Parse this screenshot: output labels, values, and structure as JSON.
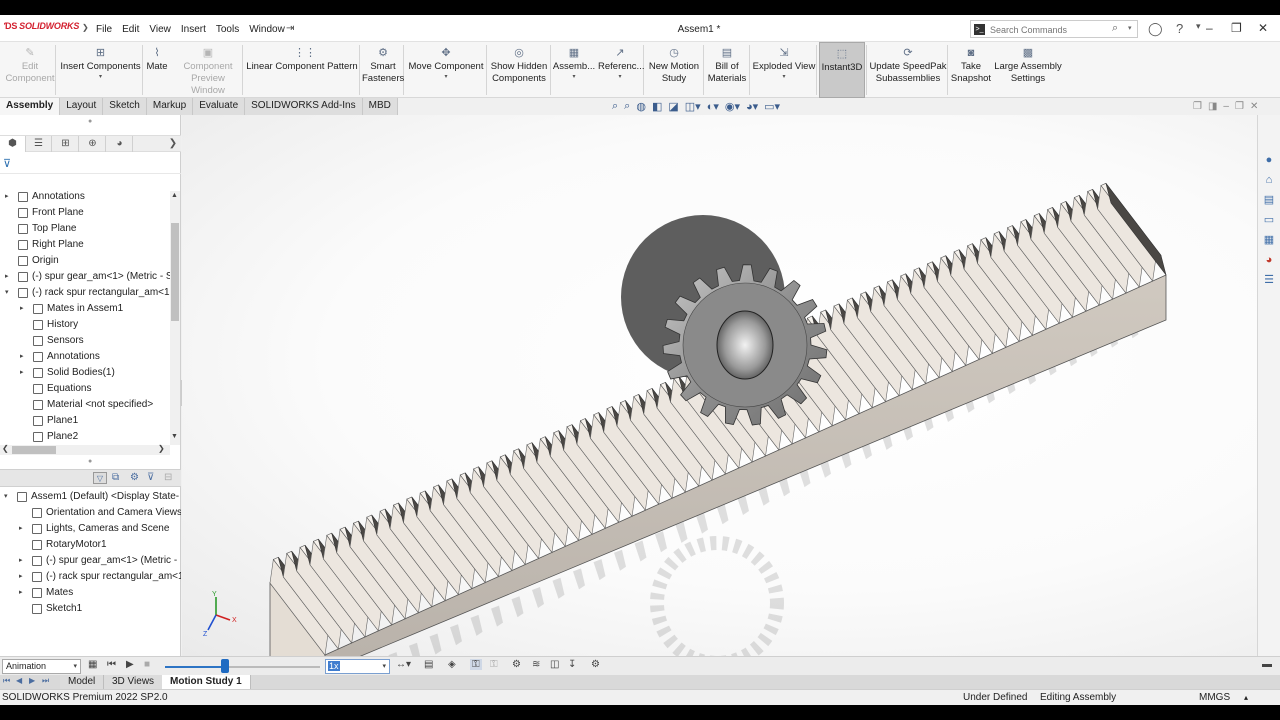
{
  "app": {
    "logo_text": "SOLIDWORKS",
    "document_title": "Assem1 *",
    "menu": [
      "File",
      "Edit",
      "View",
      "Insert",
      "Tools",
      "Window"
    ],
    "search_placeholder": "Search Commands"
  },
  "ribbon": [
    {
      "label": "Edit\nComponent",
      "icon": "edit-component-icon",
      "disabled": true
    },
    {
      "label": "Insert Components",
      "icon": "insert-components-icon"
    },
    {
      "label": "Mate",
      "icon": "mate-icon"
    },
    {
      "label": "Component\nPreview Window",
      "icon": "preview-window-icon",
      "disabled": true
    },
    {
      "label": "Linear Component Pattern",
      "icon": "linear-pattern-icon"
    },
    {
      "label": "Smart\nFasteners",
      "icon": "smart-fasteners-icon"
    },
    {
      "label": "Move Component",
      "icon": "move-component-icon"
    },
    {
      "label": "Show Hidden\nComponents",
      "icon": "show-hidden-icon"
    },
    {
      "label": "Assemb...",
      "icon": "assembly-features-icon"
    },
    {
      "label": "Referenc...",
      "icon": "reference-geometry-icon"
    },
    {
      "label": "New Motion\nStudy",
      "icon": "motion-study-icon"
    },
    {
      "label": "Bill of\nMaterials",
      "icon": "bom-icon"
    },
    {
      "label": "Exploded View",
      "icon": "exploded-view-icon"
    },
    {
      "label": "Instant3D",
      "icon": "instant3d-icon",
      "active": true
    },
    {
      "label": "Update SpeedPak\nSubassemblies",
      "icon": "speedpak-icon"
    },
    {
      "label": "Take\nSnapshot",
      "icon": "camera-icon"
    },
    {
      "label": "Large Assembly\nSettings",
      "icon": "large-assembly-icon"
    }
  ],
  "command_tabs": [
    "Assembly",
    "Layout",
    "Sketch",
    "Markup",
    "Evaluate",
    "SOLIDWORKS Add-Ins",
    "MBD"
  ],
  "feature_tree": [
    {
      "label": "Annotations",
      "indent": 0,
      "expand": "▸",
      "icon": "annotations-icon"
    },
    {
      "label": "Front Plane",
      "indent": 0,
      "icon": "plane-icon"
    },
    {
      "label": "Top Plane",
      "indent": 0,
      "icon": "plane-icon"
    },
    {
      "label": "Right Plane",
      "indent": 0,
      "icon": "plane-icon"
    },
    {
      "label": "Origin",
      "indent": 0,
      "icon": "origin-icon"
    },
    {
      "label": "(-) spur gear_am<1> (Metric - S",
      "indent": 0,
      "expand": "▸",
      "icon": "part-icon"
    },
    {
      "label": "(-) rack spur rectangular_am<1",
      "indent": 0,
      "expand": "▾",
      "icon": "part-icon"
    },
    {
      "label": "Mates in Assem1",
      "indent": 1,
      "expand": "▸",
      "icon": "mates-icon"
    },
    {
      "label": "History",
      "indent": 1,
      "icon": "history-icon"
    },
    {
      "label": "Sensors",
      "indent": 1,
      "icon": "sensors-icon"
    },
    {
      "label": "Annotations",
      "indent": 1,
      "expand": "▸",
      "icon": "annotations-icon"
    },
    {
      "label": "Solid Bodies(1)",
      "indent": 1,
      "expand": "▸",
      "icon": "solid-bodies-icon"
    },
    {
      "label": "Equations",
      "indent": 1,
      "icon": "equations-icon"
    },
    {
      "label": "Material <not specified>",
      "indent": 1,
      "icon": "material-icon"
    },
    {
      "label": "Plane1",
      "indent": 1,
      "icon": "plane-icon"
    },
    {
      "label": "Plane2",
      "indent": 1,
      "icon": "plane-icon"
    }
  ],
  "motion_tree": [
    {
      "label": "Assem1 (Default) <Display State-",
      "indent": 0,
      "expand": "▾",
      "icon": "assembly-icon"
    },
    {
      "label": "Orientation and Camera Views",
      "indent": 1,
      "icon": "camera-views-icon"
    },
    {
      "label": "Lights, Cameras and Scene",
      "indent": 1,
      "expand": "▸",
      "icon": "lights-icon"
    },
    {
      "label": "RotaryMotor1",
      "indent": 1,
      "icon": "rotary-motor-icon"
    },
    {
      "label": "(-) spur gear_am<1> (Metric -",
      "indent": 1,
      "expand": "▸",
      "icon": "part-icon"
    },
    {
      "label": "(-) rack spur rectangular_am<1",
      "indent": 1,
      "expand": "▸",
      "icon": "part-icon"
    },
    {
      "label": "Mates",
      "indent": 1,
      "expand": "▸",
      "icon": "mates-icon"
    },
    {
      "label": "Sketch1",
      "indent": 1,
      "icon": "sketch-icon"
    }
  ],
  "motion_study": {
    "type_value": "Animation",
    "speed_value": "1x",
    "timeline_position": 0.39
  },
  "bottom_tabs": [
    "Model",
    "3D Views",
    "Motion Study 1"
  ],
  "status": {
    "version": "SOLIDWORKS Premium 2022 SP2.0",
    "definition": "Under Defined",
    "mode": "Editing Assembly",
    "units": "MMGS"
  },
  "colors": {
    "brand": "#d3202f",
    "selection": "#3f7ccf",
    "gear_steel": "#9a9a9a"
  }
}
